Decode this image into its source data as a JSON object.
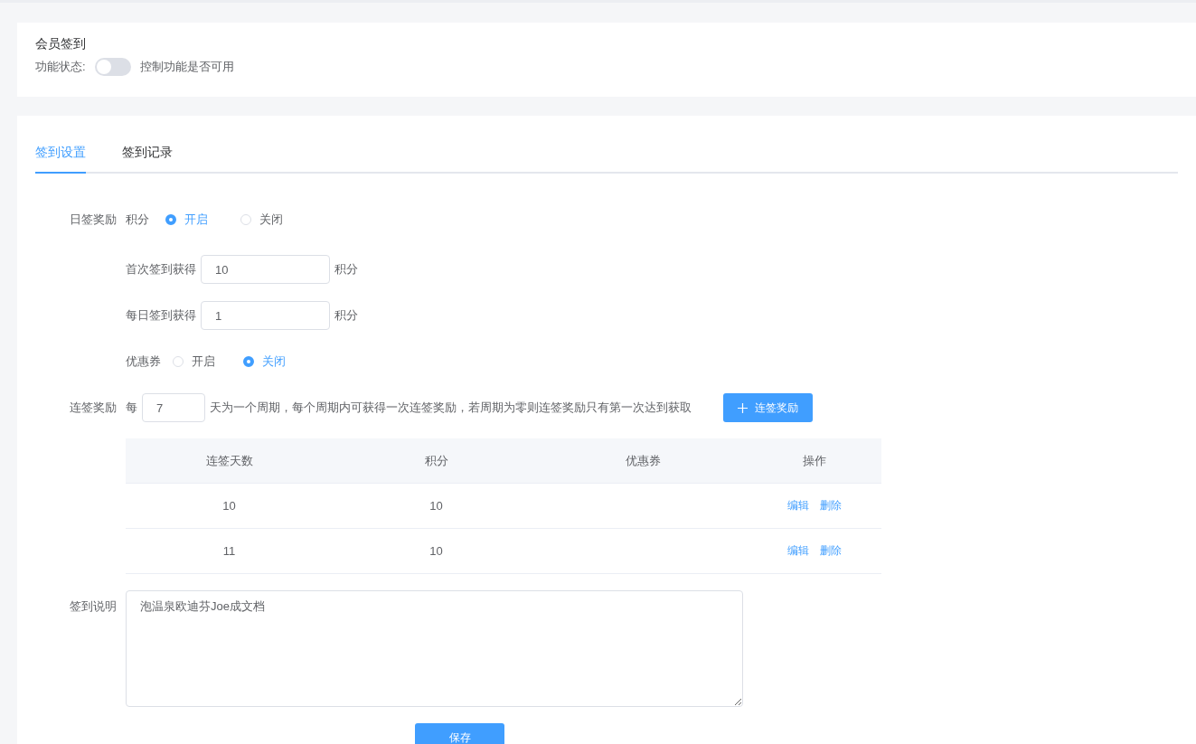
{
  "header": {
    "title": "会员签到",
    "status_label": "功能状态:",
    "toggle": {
      "on": false
    },
    "toggle_hint": "控制功能是否可用"
  },
  "tabs": [
    {
      "label": "签到设置",
      "selected": true
    },
    {
      "label": "签到记录",
      "selected": false
    }
  ],
  "daily_reward": {
    "label": "日签奖励",
    "points_label": "积分",
    "points_options": [
      {
        "label": "开启",
        "selected": true
      },
      {
        "label": "关闭",
        "selected": false
      }
    ],
    "fields": [
      {
        "label": "首次签到获得",
        "value": "10",
        "unit": "积分"
      },
      {
        "label": "每日签到获得",
        "value": "1",
        "unit": "积分"
      }
    ],
    "coupon_label": "优惠券",
    "coupon_options": [
      {
        "label": "开启",
        "selected": false
      },
      {
        "label": "关闭",
        "selected": true
      }
    ]
  },
  "streak_reward": {
    "label": "连签奖励",
    "prefix": "每",
    "cycle_value": "7",
    "description": "天为一个周期，每个周期内可获得一次连签奖励，若周期为零则连签奖励只有第一次达到获取",
    "add_button": "连签奖励",
    "table": {
      "columns": [
        "连签天数",
        "积分",
        "优惠券",
        "操作"
      ],
      "rows": [
        {
          "days": "10",
          "points": "10",
          "coupon": "",
          "actions": [
            "编辑",
            "删除"
          ]
        },
        {
          "days": "11",
          "points": "10",
          "coupon": "",
          "actions": [
            "编辑",
            "删除"
          ]
        }
      ]
    }
  },
  "notes": {
    "label": "签到说明",
    "value": "泡温泉欧迪芬Joe成文档"
  },
  "save_button": "保存"
}
